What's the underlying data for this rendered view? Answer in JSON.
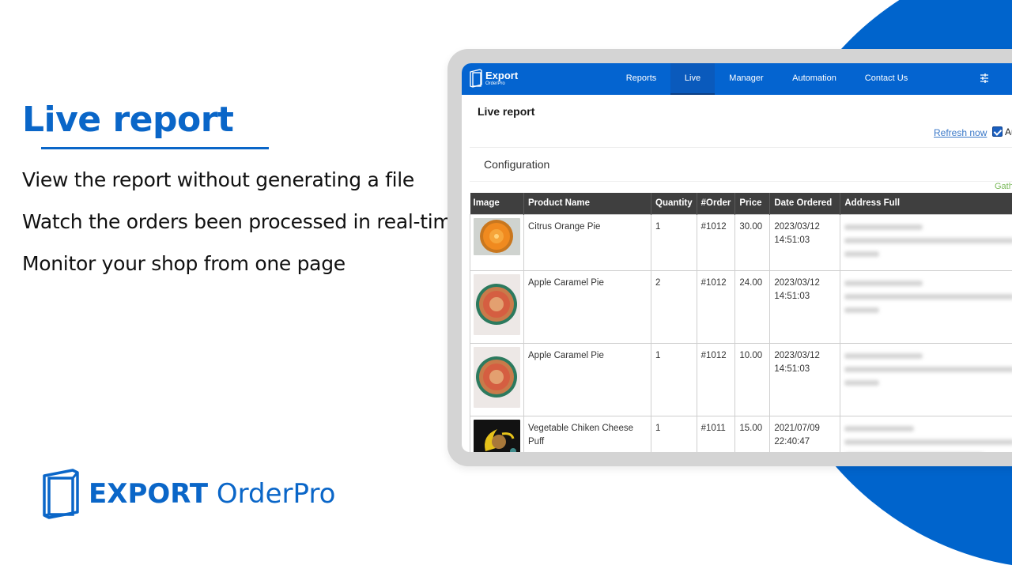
{
  "hero": {
    "title": "Live report",
    "features": [
      "View the report without generating a file",
      "Watch the orders been processed in real-time",
      "Monitor your shop from one page"
    ]
  },
  "brand": {
    "bold": "EXPORT",
    "light": " OrderPro",
    "color": "#0a66c8"
  },
  "app": {
    "logo": {
      "line1": "Export",
      "line2": "OrderPro"
    },
    "nav": [
      {
        "label": "Reports",
        "active": false
      },
      {
        "label": "Live",
        "active": true
      },
      {
        "label": "Manager",
        "active": false
      },
      {
        "label": "Automation",
        "active": false
      },
      {
        "label": "Contact Us",
        "active": false
      }
    ],
    "nav_color": "#0464d0",
    "settings_icon": "sliders-icon",
    "page_title": "Live report",
    "refresh_label": "Refresh now",
    "auto_refresh": {
      "label": "Au",
      "checked": true
    },
    "config_label": "Configuration",
    "gathered_label": "Gathere",
    "table": {
      "headers": [
        "Image",
        "Product Name",
        "Quantity",
        "#Order",
        "Price",
        "Date Ordered",
        "Address Full"
      ],
      "rows": [
        {
          "product": "Citrus Orange Pie",
          "quantity": "1",
          "order": "#1012",
          "price": "30.00",
          "date": "2023/03/12",
          "time": "14:51:03",
          "address": "(blurred)"
        },
        {
          "product": "Apple Caramel Pie",
          "quantity": "2",
          "order": "#1012",
          "price": "24.00",
          "date": "2023/03/12",
          "time": "14:51:03",
          "address": "(blurred)"
        },
        {
          "product": "Apple Caramel Pie",
          "quantity": "1",
          "order": "#1012",
          "price": "10.00",
          "date": "2023/03/12",
          "time": "14:51:03",
          "address": "(blurred)"
        },
        {
          "product": "Vegetable Chiken Cheese Puff",
          "quantity": "1",
          "order": "#1011",
          "price": "15.00",
          "date": "2021/07/09",
          "time": "22:40:47",
          "address": "(blurred)"
        }
      ]
    }
  }
}
